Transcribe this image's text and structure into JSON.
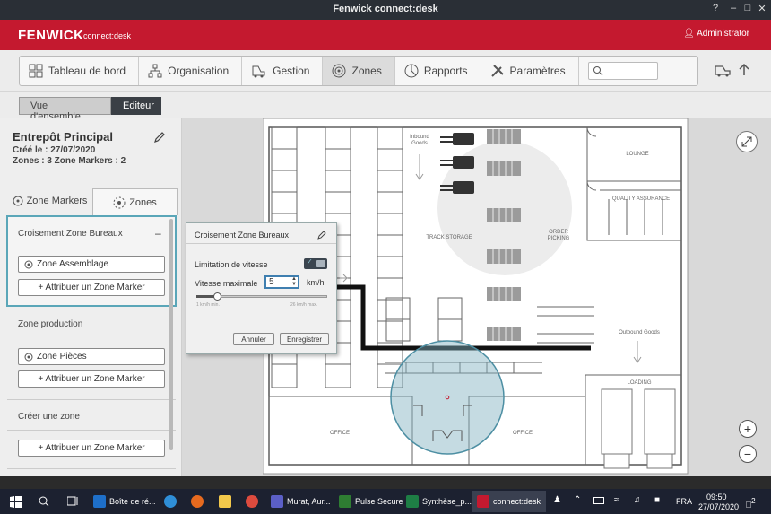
{
  "window": {
    "title": "Fenwick connect:desk",
    "controls": [
      "?",
      "–",
      "□",
      "✕"
    ]
  },
  "brand": {
    "logo": "FENWICK",
    "product": "connect:desk",
    "user": "Administrator"
  },
  "nav": {
    "items": [
      {
        "label": "Tableau de bord",
        "icon": "dashboard-icon"
      },
      {
        "label": "Organisation",
        "icon": "org-chart-icon"
      },
      {
        "label": "Gestion",
        "icon": "forklift-icon"
      },
      {
        "label": "Zones",
        "icon": "target-icon",
        "active": true
      },
      {
        "label": "Rapports",
        "icon": "pie-chart-icon"
      },
      {
        "label": "Paramètres",
        "icon": "tools-icon"
      }
    ],
    "search_placeholder": ""
  },
  "breadcrumb": {
    "overview": "Vue d'ensemble",
    "editor": "Editeur"
  },
  "site": {
    "name": "Entrepôt Principal",
    "created": "Créé le : 27/07/2020",
    "counts": "Zones : 3  Zone Markers : 2"
  },
  "tabs": {
    "markers": "Zone Markers",
    "zones": "Zones"
  },
  "zones": [
    {
      "name": "Croisement Zone Bureaux",
      "collapse": "–",
      "marker": "Zone Assemblage",
      "assign": "+   Attribuer un Zone Marker"
    },
    {
      "name": "Zone production",
      "marker": "Zone Pièces",
      "assign": "+   Attribuer un Zone Marker"
    }
  ],
  "create_zone": {
    "label": "Créer une zone",
    "assign": "+   Attribuer un Zone Marker"
  },
  "popup": {
    "title": "Croisement Zone Bureaux",
    "speed_limit_label": "Limitation de vitesse",
    "speed_limit_on": true,
    "max_speed_label": "Vitesse maximale",
    "max_speed_value": "5",
    "unit": "km/h",
    "slider_min": "1 km/h min.",
    "slider_max": "26 km/h max.",
    "slider_value": 5,
    "cancel": "Annuler",
    "save": "Enregistrer"
  },
  "map": {
    "labels": {
      "inbound": "Inbound\nGoods",
      "lounge": "LOUNGE",
      "qa": "QUALITY ASSURANCE",
      "track": "TRACK STORAGE",
      "order": "ORDER\nPICKING",
      "outbound": "Outbound Goods",
      "loading": "LOADING",
      "office_left": "OFFICE",
      "office_right": "OFFICE"
    },
    "zoom_in": "+",
    "zoom_out": "−"
  },
  "taskbar": {
    "apps": [
      {
        "label": "Boîte de ré...",
        "color": "#1e6fc9"
      },
      {
        "label": "Murat, Aur...",
        "color": "#5b5fc7"
      },
      {
        "label": "Pulse Secure",
        "color": "#2e7d32"
      },
      {
        "label": "Synthèse_p...",
        "color": "#1e7e45"
      },
      {
        "label": "connect:desk",
        "color": "#c4192f"
      }
    ],
    "lang": "FRA",
    "time": "09:50",
    "date": "27/07/2020",
    "notifications": "2"
  }
}
